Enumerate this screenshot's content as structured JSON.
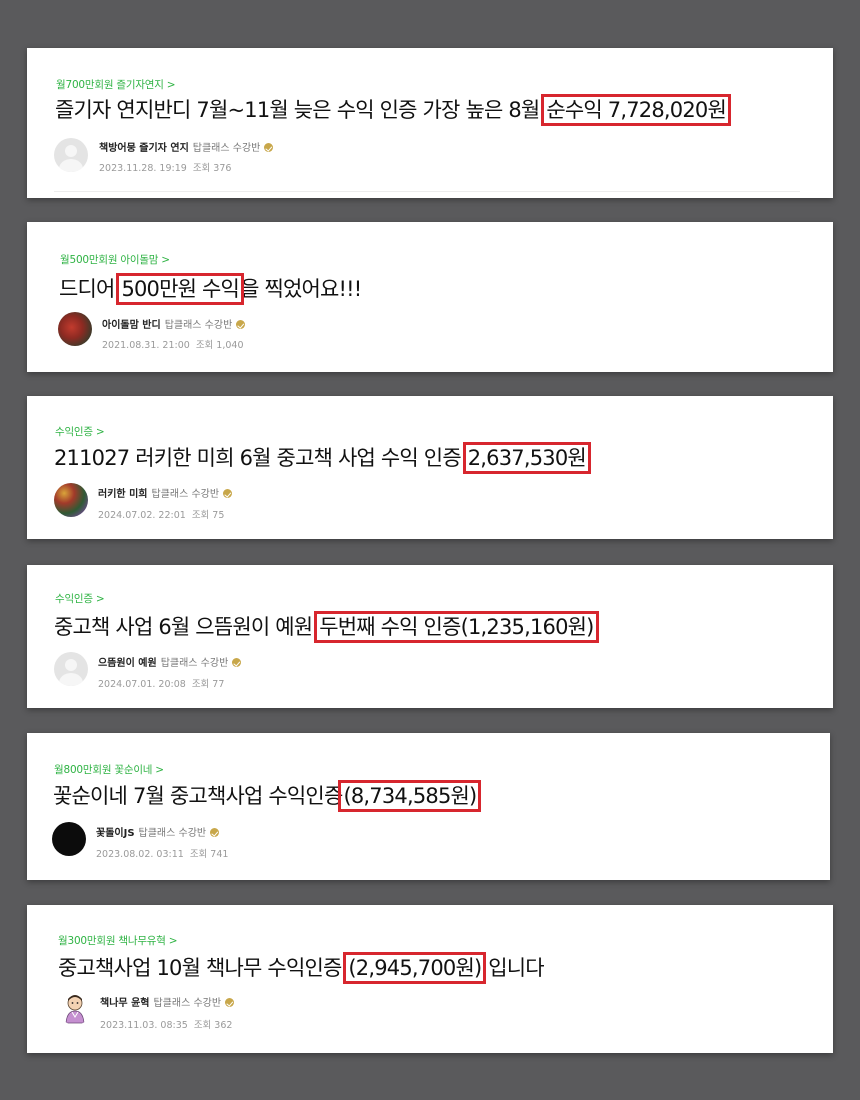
{
  "posts": [
    {
      "board": "월700만회원 즐기자연지",
      "chevron": ">",
      "title_before": "즐기자 연지반디 7월~11월 늦은 수익 인증 가장 높은 8월 ",
      "title_highlight": "순수익 7,728,020원",
      "title_after": "",
      "author": "책방어뭉 즐기자 연지",
      "grade": "탑클래스 수강반",
      "date": "2023.11.28. 19:19",
      "views_label": "조회",
      "views": "376",
      "avatar": "blank-avatar-icon"
    },
    {
      "board": "월500만회원 아이돌맘",
      "chevron": ">",
      "title_before": "드디어 ",
      "title_highlight": "500만원 수익",
      "title_after": "을 찍었어요!!!",
      "author": "아이돌맘 반디",
      "grade": "탑클래스 수강반",
      "date": "2021.08.31. 21:00",
      "views_label": "조회",
      "views": "1,040",
      "avatar": "profile-photo-icon"
    },
    {
      "board": "수익인증",
      "chevron": ">",
      "title_before": "211027 러키한 미희 6월 중고책 사업 수익 인증 ",
      "title_highlight": "2,637,530원",
      "title_after": "",
      "author": "러키한 미희",
      "grade": "탑클래스 수강반",
      "date": "2024.07.02. 22:01",
      "views_label": "조회",
      "views": "75",
      "avatar": "profile-photo-icon"
    },
    {
      "board": "수익인증",
      "chevron": ">",
      "title_before": "중고책 사업 6월 으뜸원이 예원 ",
      "title_highlight": "두번째 수익 인증(1,235,160원)",
      "title_after": "",
      "author": "으뜸원이 예원",
      "grade": "탑클래스 수강반",
      "date": "2024.07.01. 20:08",
      "views_label": "조회",
      "views": "77",
      "avatar": "blank-avatar-icon"
    },
    {
      "board": "월800만회원 꽃순이네",
      "chevron": ">",
      "title_before": "꽃순이네 7월 중고책사업 수익인증",
      "title_highlight": "(8,734,585원)",
      "title_after": "",
      "author": "꽃돌이JS",
      "grade": "탑클래스 수강반",
      "date": "2023.08.02. 03:11",
      "views_label": "조회",
      "views": "741",
      "avatar": "black-avatar-icon"
    },
    {
      "board": "월300만회원 책나무유혁",
      "chevron": ">",
      "title_before": "중고책사업 10월 책나무 수익인증 ",
      "title_highlight": "(2,945,700원)",
      "title_after": " 입니다",
      "author": "책나무 윤혁",
      "grade": "탑클래스 수강반",
      "date": "2023.11.03. 08:35",
      "views_label": "조회",
      "views": "362",
      "avatar": "character-avatar-icon"
    }
  ],
  "colors": {
    "background": "#5a5a5c",
    "board_link": "#2fb344",
    "highlight_box": "#d7262e",
    "badge": "#c8a74a"
  }
}
